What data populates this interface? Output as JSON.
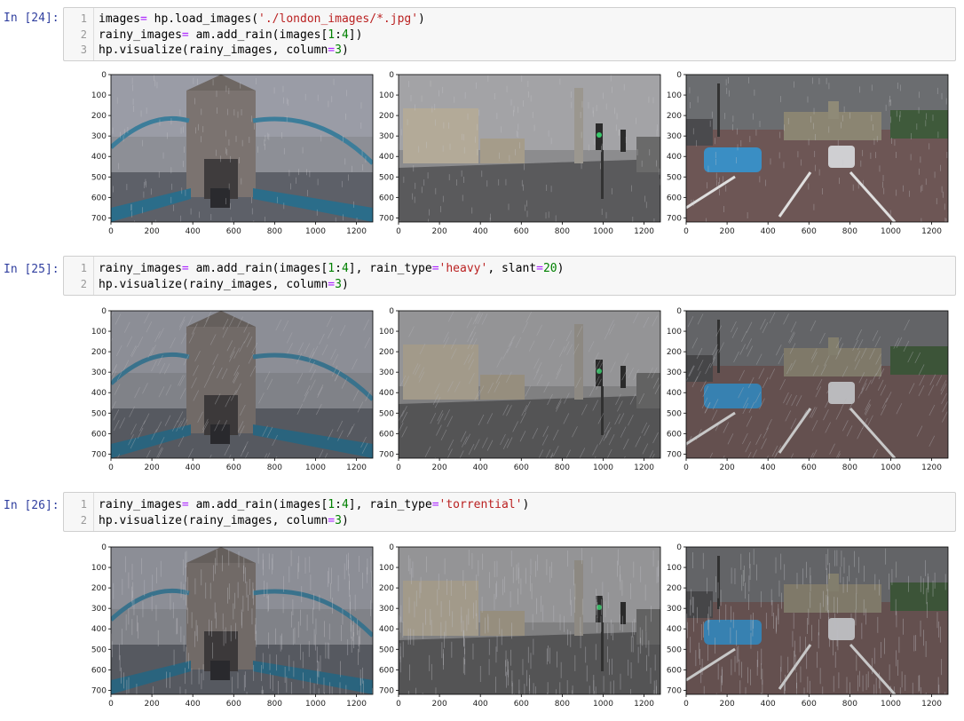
{
  "cells": [
    {
      "prompt": "In [24]:",
      "lines": [
        {
          "num": "1",
          "tokens": [
            {
              "t": "images",
              "c": ""
            },
            {
              "t": "=",
              "c": "op"
            },
            {
              "t": " hp.load_images(",
              "c": ""
            },
            {
              "t": "'./london_images/*.jpg'",
              "c": "str"
            },
            {
              "t": ")",
              "c": ""
            }
          ]
        },
        {
          "num": "2",
          "tokens": [
            {
              "t": "rainy_images",
              "c": ""
            },
            {
              "t": "=",
              "c": "op"
            },
            {
              "t": " am.add_rain(images[",
              "c": ""
            },
            {
              "t": "1",
              "c": "num"
            },
            {
              "t": ":",
              "c": ""
            },
            {
              "t": "4",
              "c": "num"
            },
            {
              "t": "])",
              "c": ""
            }
          ]
        },
        {
          "num": "3",
          "tokens": [
            {
              "t": "hp.visualize(rainy_images, column",
              "c": ""
            },
            {
              "t": "=",
              "c": "op"
            },
            {
              "t": "3",
              "c": "num"
            },
            {
              "t": ")",
              "c": ""
            }
          ]
        }
      ]
    },
    {
      "prompt": "In [25]:",
      "lines": [
        {
          "num": "1",
          "tokens": [
            {
              "t": "rainy_images",
              "c": ""
            },
            {
              "t": "=",
              "c": "op"
            },
            {
              "t": " am.add_rain(images[",
              "c": ""
            },
            {
              "t": "1",
              "c": "num"
            },
            {
              "t": ":",
              "c": ""
            },
            {
              "t": "4",
              "c": "num"
            },
            {
              "t": "], rain_type",
              "c": ""
            },
            {
              "t": "=",
              "c": "op"
            },
            {
              "t": "'heavy'",
              "c": "str"
            },
            {
              "t": ", slant",
              "c": ""
            },
            {
              "t": "=",
              "c": "op"
            },
            {
              "t": "20",
              "c": "num"
            },
            {
              "t": ")",
              "c": ""
            }
          ]
        },
        {
          "num": "2",
          "tokens": [
            {
              "t": "hp.visualize(rainy_images, column",
              "c": ""
            },
            {
              "t": "=",
              "c": "op"
            },
            {
              "t": "3",
              "c": "num"
            },
            {
              "t": ")",
              "c": ""
            }
          ]
        }
      ]
    },
    {
      "prompt": "In [26]:",
      "lines": [
        {
          "num": "1",
          "tokens": [
            {
              "t": "rainy_images",
              "c": ""
            },
            {
              "t": "=",
              "c": "op"
            },
            {
              "t": " am.add_rain(images[",
              "c": ""
            },
            {
              "t": "1",
              "c": "num"
            },
            {
              "t": ":",
              "c": ""
            },
            {
              "t": "4",
              "c": "num"
            },
            {
              "t": "], rain_type",
              "c": ""
            },
            {
              "t": "=",
              "c": "op"
            },
            {
              "t": "'torrential'",
              "c": "str"
            },
            {
              "t": ")",
              "c": ""
            }
          ]
        },
        {
          "num": "2",
          "tokens": [
            {
              "t": "hp.visualize(rainy_images, column",
              "c": ""
            },
            {
              "t": "=",
              "c": "op"
            },
            {
              "t": "3",
              "c": "num"
            },
            {
              "t": ")",
              "c": ""
            }
          ]
        }
      ]
    }
  ],
  "axes": {
    "y_ticks": [
      "0",
      "100",
      "200",
      "300",
      "400",
      "500",
      "600",
      "700"
    ],
    "x_ticks": [
      "0",
      "200",
      "400",
      "600",
      "800",
      "1000",
      "1200"
    ]
  },
  "images": [
    {
      "scene": "tower-bridge",
      "rain": "drizzle"
    },
    {
      "scene": "trafalgar-square",
      "rain": "drizzle"
    },
    {
      "scene": "buckingham-palace",
      "rain": "drizzle"
    },
    {
      "scene": "tower-bridge",
      "rain": "heavy"
    },
    {
      "scene": "trafalgar-square",
      "rain": "heavy"
    },
    {
      "scene": "buckingham-palace",
      "rain": "heavy"
    },
    {
      "scene": "tower-bridge",
      "rain": "torrential"
    },
    {
      "scene": "trafalgar-square",
      "rain": "torrential"
    },
    {
      "scene": "buckingham-palace",
      "rain": "torrential"
    }
  ],
  "colors": {
    "prompt": "#303f9f",
    "string": "#ba2121",
    "number": "#008000",
    "operator": "#aa22ff",
    "cell_bg": "#f7f7f7"
  }
}
